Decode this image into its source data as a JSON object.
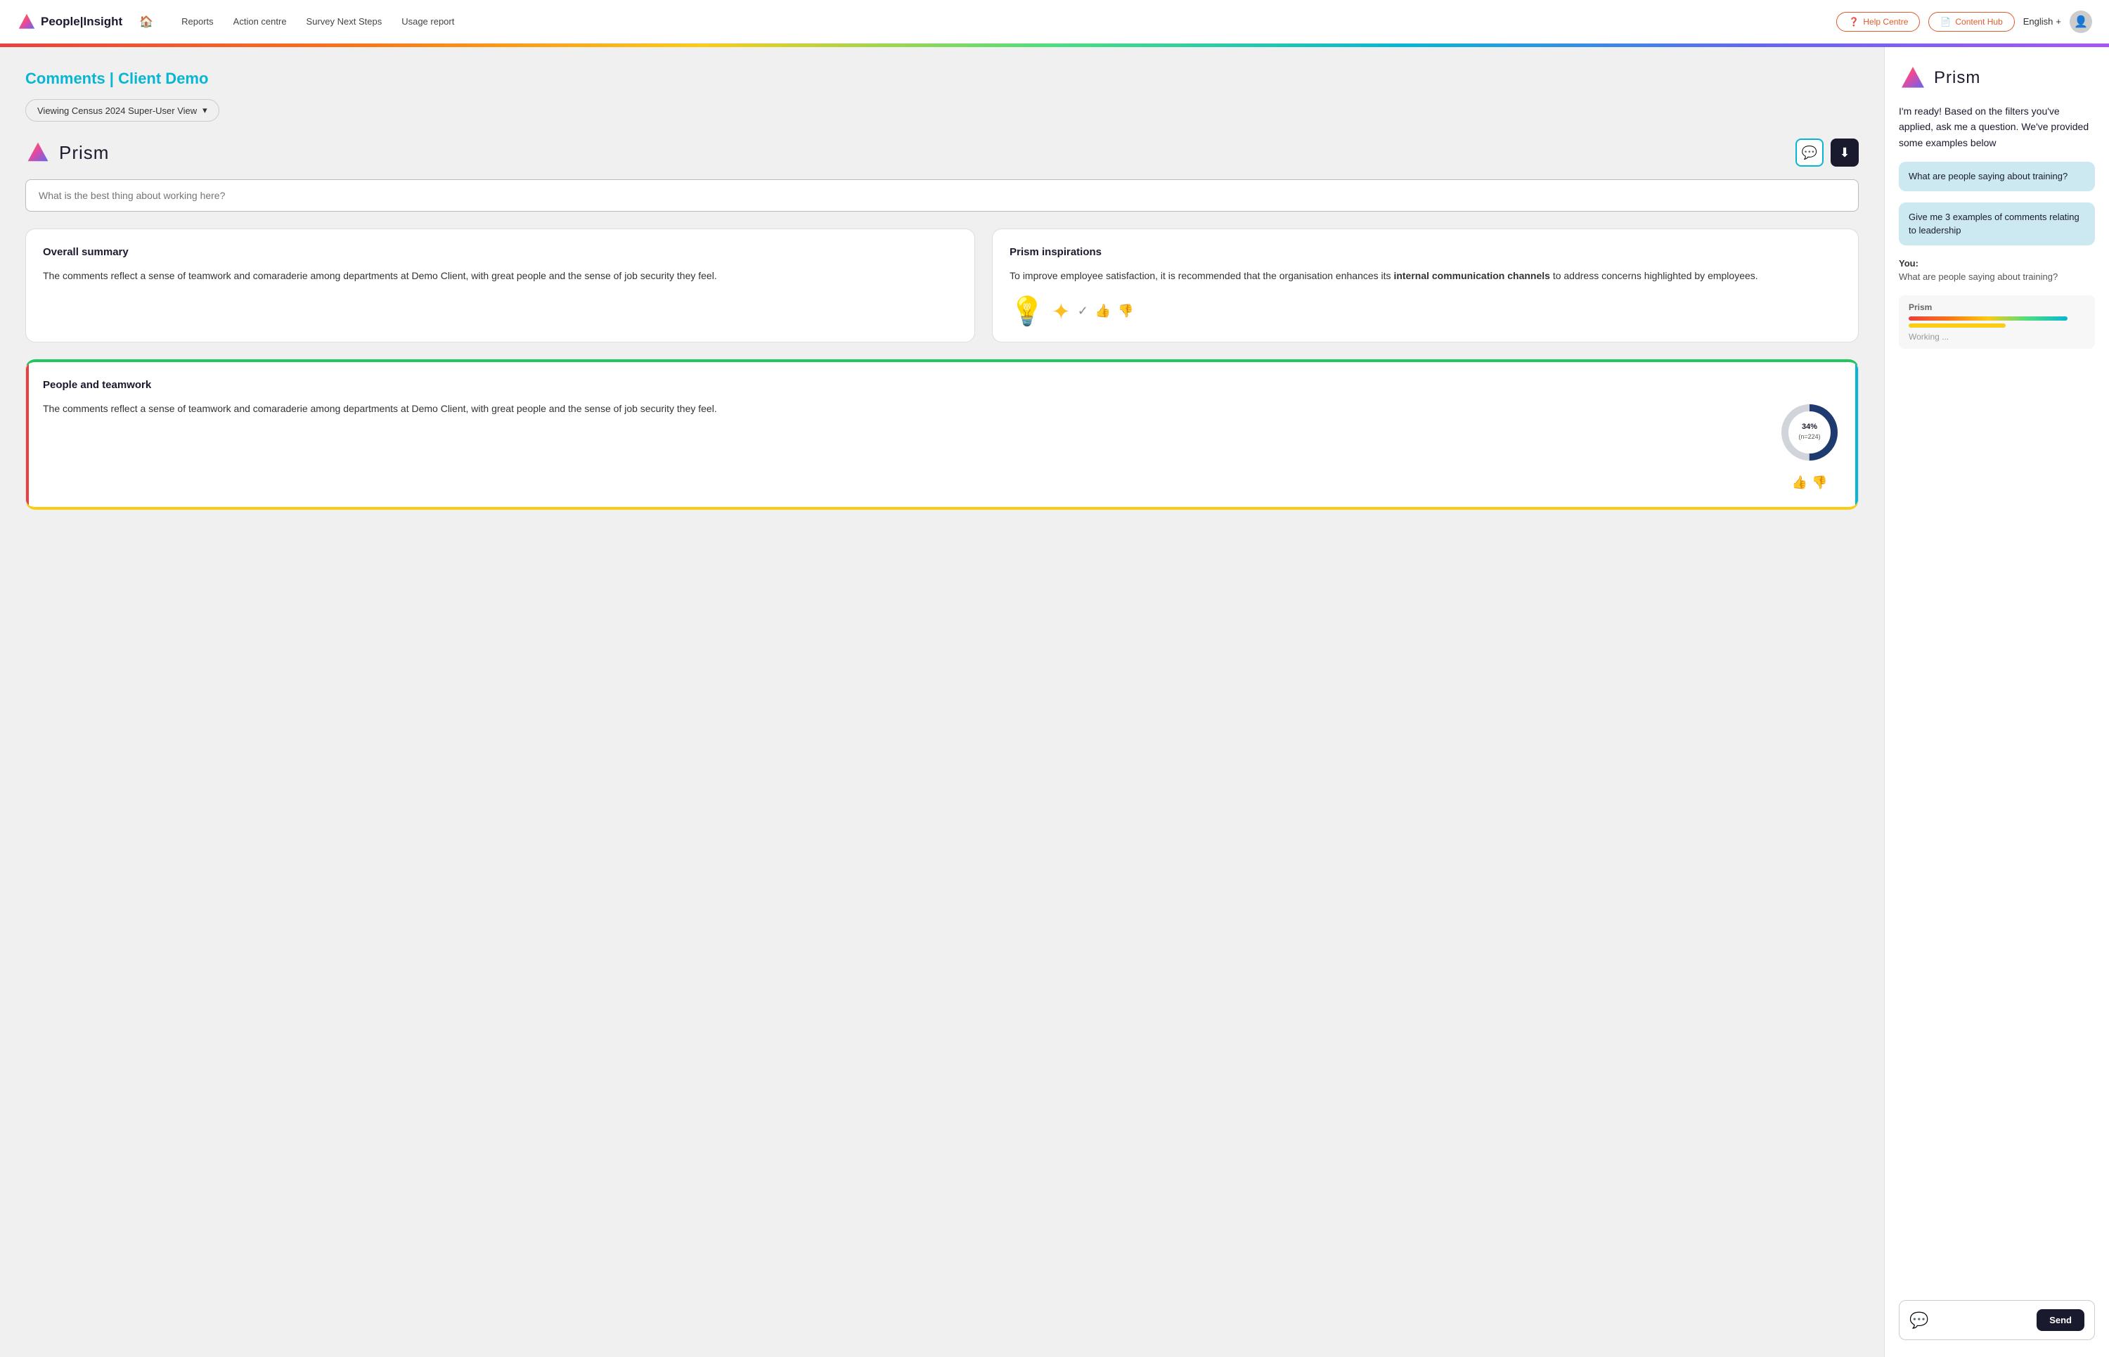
{
  "app": {
    "logo_text": "People|Insight",
    "home_icon": "🏠"
  },
  "nav": {
    "links": [
      "Reports",
      "Action centre",
      "Survey Next Steps",
      "Usage report"
    ],
    "help_btn": "Help Centre",
    "content_btn": "Content Hub",
    "language": "English",
    "language_icon": "+"
  },
  "page": {
    "title_static": "Comments |",
    "title_dynamic": "Client Demo",
    "filter_label": "Viewing Census 2024 Super-User View",
    "filter_icon": "▾"
  },
  "prism_header": {
    "title": "Prism",
    "search_placeholder": "What is the best thing about working here?",
    "btn1_icon": "💬",
    "btn2_icon": "⬇"
  },
  "overall_summary": {
    "title": "Overall summary",
    "text": "The comments reflect a sense of teamwork and comaraderie among departments at Demo Client, with great people and the sense of job security they feel."
  },
  "prism_inspirations": {
    "title": "Prism inspirations",
    "text": "To improve employee satisfaction, it is recommended that the organisation enhances its **internal communication channels** to address concerns highlighted by employees."
  },
  "people_teamwork": {
    "title": "People and teamwork",
    "text": "The comments reflect a sense of teamwork and comaraderie among departments at Demo Client, with great people and the sense of job security they feel.",
    "donut": {
      "percentage": "34%",
      "label": "(n=224)",
      "filled_color": "#1e3a6e",
      "empty_color": "#d1d5db",
      "filled_degrees": 122
    }
  },
  "prism_panel": {
    "title": "Prism",
    "intro": "I'm ready! Based on the filters you've applied, ask me a question. We've provided some examples below",
    "suggestions": [
      "What are people saying about training?",
      "Give me 3 examples of comments relating to leadership"
    ],
    "user_label": "You:",
    "user_msg": "What are people saying about training?",
    "thinking_label": "Prism",
    "thinking_bar1_color": "#e94040",
    "thinking_bar1_width": "70%",
    "thinking_bar2_color": "#facc15",
    "thinking_bar2_width": "50%",
    "thinking_sub": "Working ...",
    "send_btn": "Send",
    "chat_bubble_icon": "💬"
  },
  "icons": {
    "help_icon": "❓",
    "content_icon": "📄",
    "thumbs_up": "👍",
    "thumbs_down": "👎",
    "check": "✓",
    "lightbulb": "💡"
  }
}
